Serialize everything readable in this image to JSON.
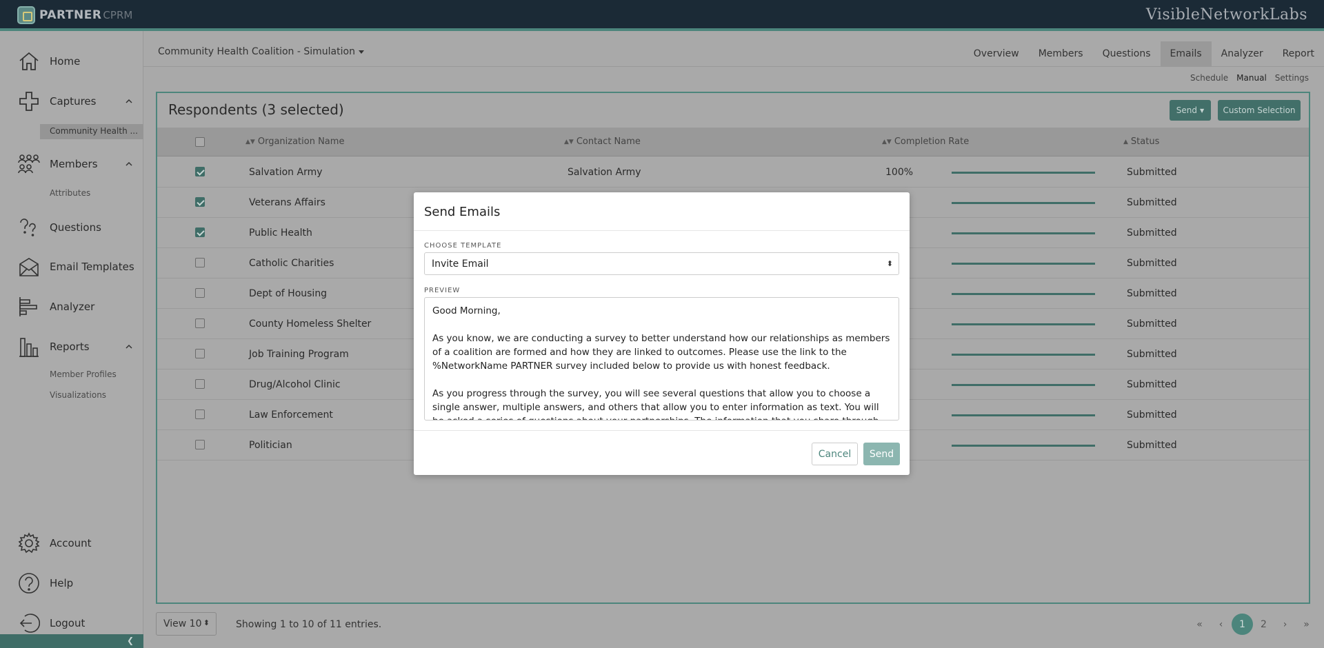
{
  "app": {
    "brand_name": "PARTNER",
    "brand_sub": "CPRM",
    "company": "VisibleNetworkLabs"
  },
  "sidebar": {
    "home": "Home",
    "captures": "Captures",
    "captures_sub": "Community Health ...",
    "members": "Members",
    "members_sub": "Attributes",
    "questions": "Questions",
    "email_templates": "Email Templates",
    "analyzer": "Analyzer",
    "reports": "Reports",
    "reports_sub1": "Member Profiles",
    "reports_sub2": "Visualizations",
    "account": "Account",
    "help": "Help",
    "logout": "Logout"
  },
  "header": {
    "coalition": "Community Health Coalition - Simulation",
    "tabs": [
      "Overview",
      "Members",
      "Questions",
      "Emails",
      "Analyzer",
      "Report"
    ],
    "active_tab": "Emails",
    "subtabs": [
      "Schedule",
      "Manual",
      "Settings"
    ],
    "active_subtab": "Manual"
  },
  "panel": {
    "title": "Respondents (3 selected)",
    "send_label": "Send",
    "custom_selection_label": "Custom Selection",
    "columns": {
      "organization": "Organization Name",
      "contact": "Contact Name",
      "completion": "Completion Rate",
      "status": "Status"
    },
    "rows": [
      {
        "org": "Salvation Army",
        "contact": "Salvation Army",
        "rate": "100%",
        "rate_value": 1.0,
        "status": "Submitted",
        "checked": true
      },
      {
        "org": "Veterans Affairs",
        "contact": "",
        "rate": "",
        "rate_value": 1.0,
        "status": "Submitted",
        "checked": true
      },
      {
        "org": "Public Health",
        "contact": "",
        "rate": "",
        "rate_value": 1.0,
        "status": "Submitted",
        "checked": true
      },
      {
        "org": "Catholic Charities",
        "contact": "",
        "rate": "",
        "rate_value": 1.0,
        "status": "Submitted",
        "checked": false
      },
      {
        "org": "Dept of Housing",
        "contact": "",
        "rate": "",
        "rate_value": 1.0,
        "status": "Submitted",
        "checked": false
      },
      {
        "org": "County Homeless Shelter",
        "contact": "",
        "rate": "",
        "rate_value": 1.0,
        "status": "Submitted",
        "checked": false
      },
      {
        "org": "Job Training Program",
        "contact": "",
        "rate": "",
        "rate_value": 1.0,
        "status": "Submitted",
        "checked": false
      },
      {
        "org": "Drug/Alcohol Clinic",
        "contact": "",
        "rate": "",
        "rate_value": 1.0,
        "status": "Submitted",
        "checked": false
      },
      {
        "org": "Law Enforcement",
        "contact": "",
        "rate": "",
        "rate_value": 1.0,
        "status": "Submitted",
        "checked": false
      },
      {
        "org": "Politician",
        "contact": "",
        "rate": "",
        "rate_value": 1.0,
        "status": "Submitted",
        "checked": false
      }
    ]
  },
  "footer": {
    "view_select": "View 10",
    "showing": "Showing 1 to 10 of 11 entries.",
    "pager": [
      "«",
      "‹",
      "1",
      "2",
      "›",
      "»"
    ],
    "current_page": "1"
  },
  "modal": {
    "title": "Send Emails",
    "template_label": "CHOOSE TEMPLATE",
    "template_value": "Invite Email",
    "preview_label": "PREVIEW",
    "preview_paragraphs": [
      "Good Morning,",
      "As you know, we are conducting a survey to better understand how our relationships as members of a coalition are formed and how they are linked to outcomes. Please use the link to the %NetworkName PARTNER survey included below to provide us with honest feedback.",
      "As you progress through the survey, you will see several questions that allow you to choose a single answer, multiple answers, and others that allow you to enter information as text. You will be asked a series of questions about your partnerships. The information that you share through this survey will help guide"
    ],
    "cancel_label": "Cancel",
    "send_label": "Send"
  },
  "colors": {
    "accent": "#4c857c",
    "topbar": "#1b2a36"
  }
}
